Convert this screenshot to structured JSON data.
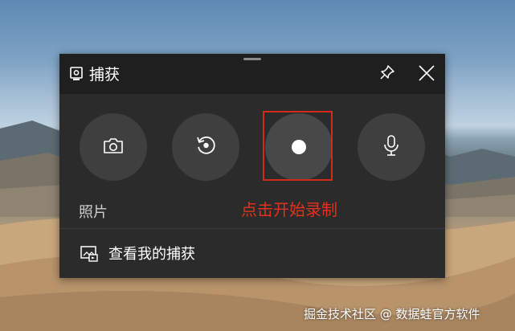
{
  "window": {
    "title": "捕获",
    "icons": [
      "capture-icon",
      "pin-icon",
      "close-icon"
    ]
  },
  "buttons": [
    {
      "name": "screenshot",
      "icon": "camera-icon"
    },
    {
      "name": "recent-capture",
      "icon": "replay-icon"
    },
    {
      "name": "start-recording",
      "icon": "record-dot-icon"
    },
    {
      "name": "microphone",
      "icon": "microphone-icon"
    }
  ],
  "labels": {
    "photo": "照片",
    "annotation": "点击开始录制"
  },
  "gallery": {
    "label": "查看我的捕获",
    "icon": "gallery-icon"
  },
  "watermark": "掘金技术社区 @ 数据蛙官方软件",
  "colors": {
    "panel": "#2b2b2b",
    "titlebar": "#1f1f1f",
    "button": "#3f3f3f",
    "annotation_red": "#e0321c"
  }
}
